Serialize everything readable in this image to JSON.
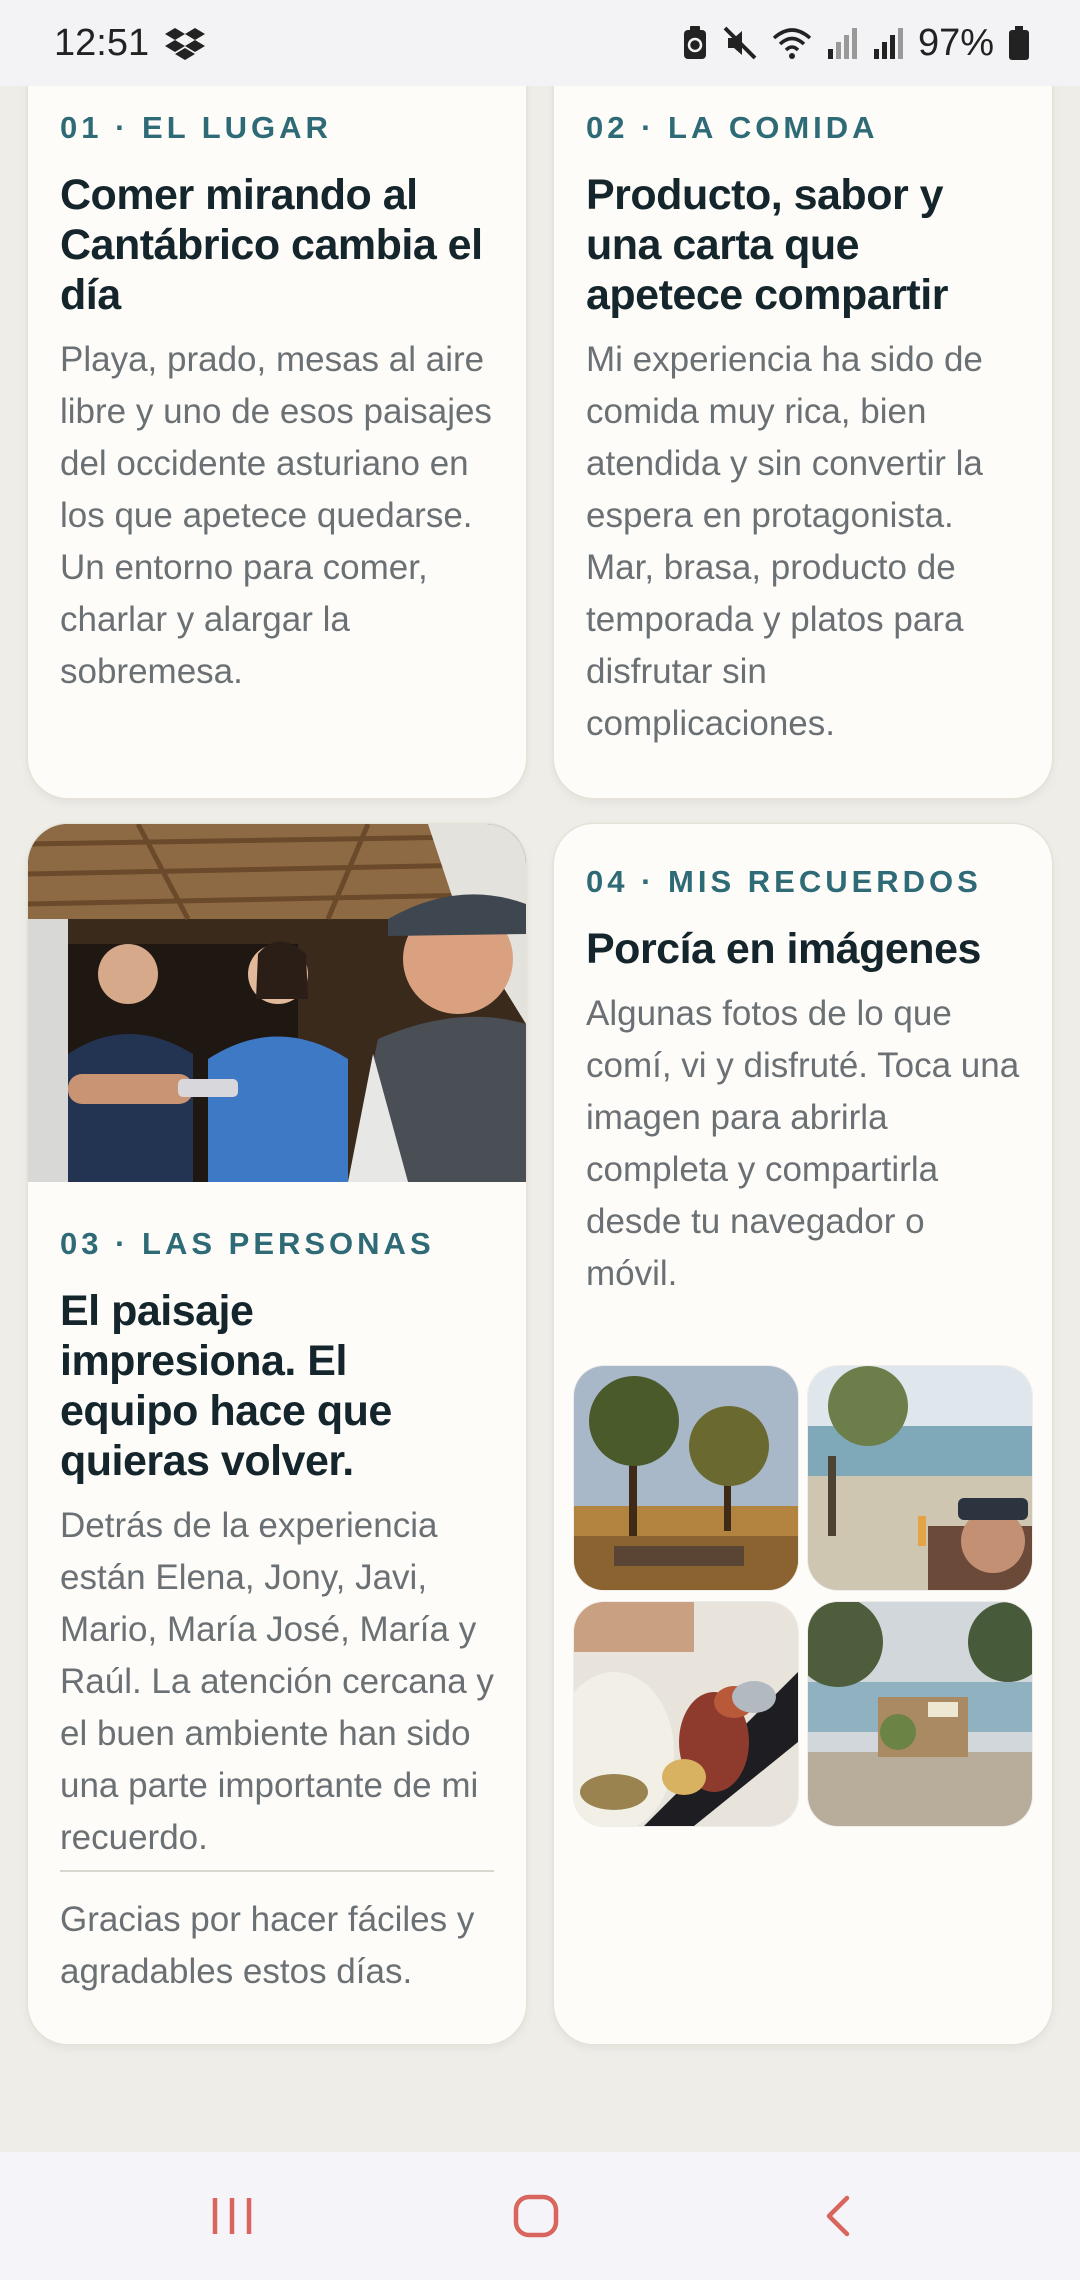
{
  "status_bar": {
    "time": "12:51",
    "battery": "97%",
    "icons": [
      "dropbox-icon",
      "battery-saver-icon",
      "mute-icon",
      "wifi-icon",
      "signal-icon",
      "signal-icon",
      "battery-icon"
    ]
  },
  "cards": [
    {
      "kicker": "01 · EL LUGAR",
      "title": "Comer mirando al Cantábrico cambia el día",
      "body": "Playa, prado, mesas al aire libre y uno de esos paisajes del occidente asturiano en los que apetece quedarse. Un entorno para comer, charlar y alargar la sobremesa."
    },
    {
      "kicker": "02 · LA COMIDA",
      "title": "Producto, sabor y una carta que apetece compartir",
      "body": "Mi experiencia ha sido de comida muy rica, bien atendida y sin convertir la espera en protagonista. Mar, brasa, producto de temporada y platos para disfrutar sin complicaciones."
    },
    {
      "kicker": "03 · LAS PERSONAS",
      "title": "El paisaje impresiona. El equipo hace que quieras volver.",
      "body": "Detrás de la experiencia están Elena, Jony, Javi, Mario, María José, María y Raúl. La atención cercana y el buen ambiente han sido una parte importante de mi recuerdo.",
      "footer": "Gracias por hacer fáciles y agradables estos días."
    },
    {
      "kicker": "04 · MIS RECUERDOS",
      "title": "Porcía en imágenes",
      "body": "Algunas fotos de lo que comí, vi y disfruté. Toca una imagen para abrirla completa y compartirla desde tu navegador o móvil.",
      "gallery": [
        "photo-trees-sunset",
        "photo-sea-view-terrace",
        "photo-grilled-food",
        "photo-beach-bar-hut"
      ]
    }
  ],
  "nav": {
    "buttons": [
      "recent-apps-icon",
      "home-icon",
      "back-icon"
    ],
    "color": "#d9655f"
  }
}
